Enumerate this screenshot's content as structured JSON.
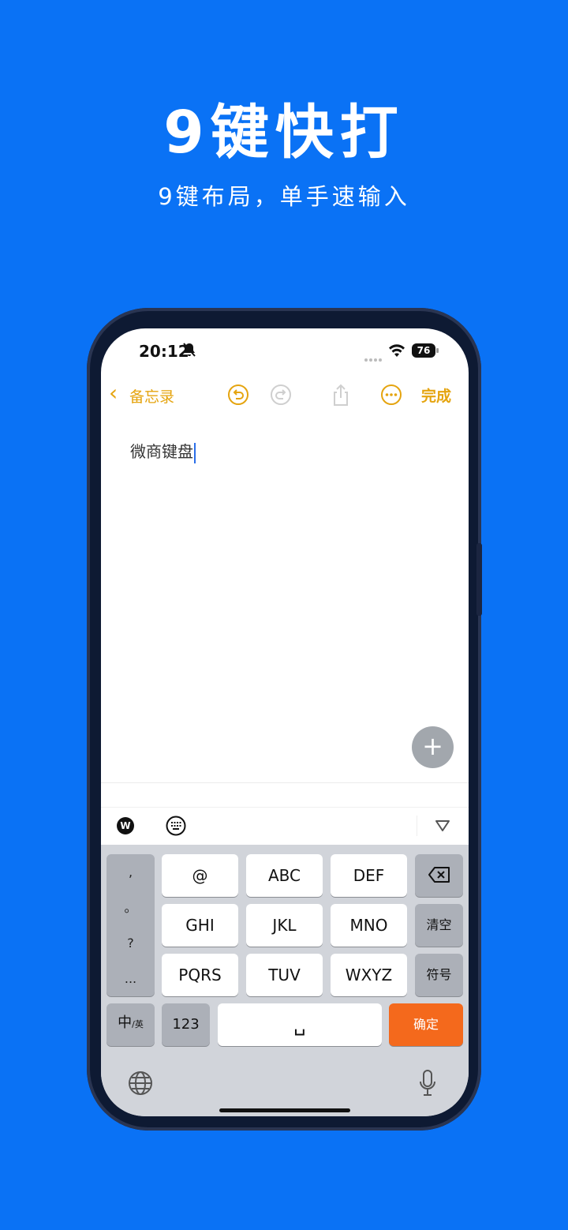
{
  "promo": {
    "title": "9键快打",
    "subtitle": "9键布局，单手速输入"
  },
  "status_bar": {
    "time": "20:12",
    "battery": "76"
  },
  "notes_nav": {
    "back_label": "备忘录",
    "done_label": "完成"
  },
  "note": {
    "content": "微商键盘"
  },
  "keyboard": {
    "punctuation": [
      ",",
      "。",
      "?",
      "..."
    ],
    "keys_row1": [
      "@",
      "ABC",
      "DEF"
    ],
    "keys_row2": [
      "GHI",
      "JKL",
      "MNO"
    ],
    "keys_row3": [
      "PQRS",
      "TUV",
      "WXYZ"
    ],
    "clear_label": "清空",
    "symbol_label": "符号",
    "lang_main": "中",
    "lang_sub": "/英",
    "num_label": "123",
    "space_label": "␣",
    "confirm_label": "确定",
    "toolbar_logo": "W"
  },
  "colors": {
    "background": "#0a72f5",
    "accent": "#e5a40f",
    "confirm": "#f4691c"
  }
}
